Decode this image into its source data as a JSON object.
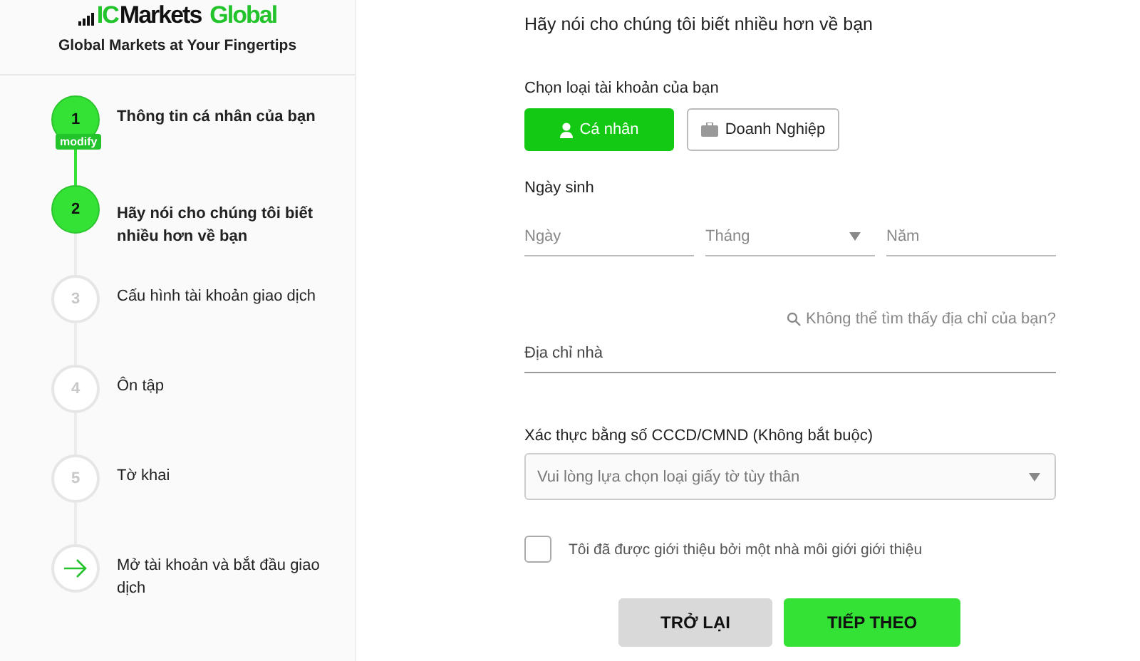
{
  "brand": {
    "logo_parts": [
      {
        "text": "IC",
        "color": "#22c32b"
      },
      {
        "text": "Markets",
        "color": "#111111"
      },
      {
        "text": "Global",
        "color": "#22c32b"
      }
    ],
    "tagline": "Global Markets at Your Fingertips"
  },
  "steps": [
    {
      "kind": "number",
      "number": "1",
      "label": "Thông tin cá nhân của bạn",
      "active": true,
      "badge": "modify"
    },
    {
      "kind": "number",
      "number": "2",
      "label": "Hãy nói cho chúng tôi biết nhiều hơn về bạn",
      "active": true
    },
    {
      "kind": "number",
      "number": "3",
      "label": "Cấu hình tài khoản giao dịch",
      "active": false
    },
    {
      "kind": "number",
      "number": "4",
      "label": "Ôn tập",
      "active": false
    },
    {
      "kind": "number",
      "number": "5",
      "label": "Tờ khai",
      "active": false
    },
    {
      "kind": "arrow",
      "label": "Mở tài khoản và bắt đầu giao dịch",
      "active": false
    }
  ],
  "form": {
    "title": "Hãy nói cho chúng tôi biết nhiều hơn về bạn",
    "account_type": {
      "label": "Chọn loại tài khoản của bạn",
      "options": [
        {
          "label": "Cá nhân",
          "selected": true
        },
        {
          "label": "Doanh Nghiệp",
          "selected": false
        }
      ]
    },
    "birth_date": {
      "label": "Ngày sinh",
      "fields": [
        {
          "placeholder": "Ngày",
          "kind": "text"
        },
        {
          "placeholder": "Tháng",
          "kind": "select"
        },
        {
          "placeholder": "Năm",
          "kind": "text"
        }
      ]
    },
    "address_help": "Không thể tìm thấy địa chỉ của bạn?",
    "address": {
      "placeholder": "Địa chỉ nhà"
    },
    "id_verification": {
      "label": "Xác thực bằng số CCCD/CMND (Không bắt buộc)",
      "placeholder": "Vui lòng lựa chọn loại giấy tờ tùy thân"
    },
    "referral": {
      "label": "Tôi đã được giới thiệu bởi một nhà môi giới giới thiệu",
      "checked": false
    },
    "buttons": [
      {
        "label": "TRỞ LẠI",
        "kind": "secondary"
      },
      {
        "label": "TIẾP THEO",
        "kind": "primary"
      }
    ]
  }
}
